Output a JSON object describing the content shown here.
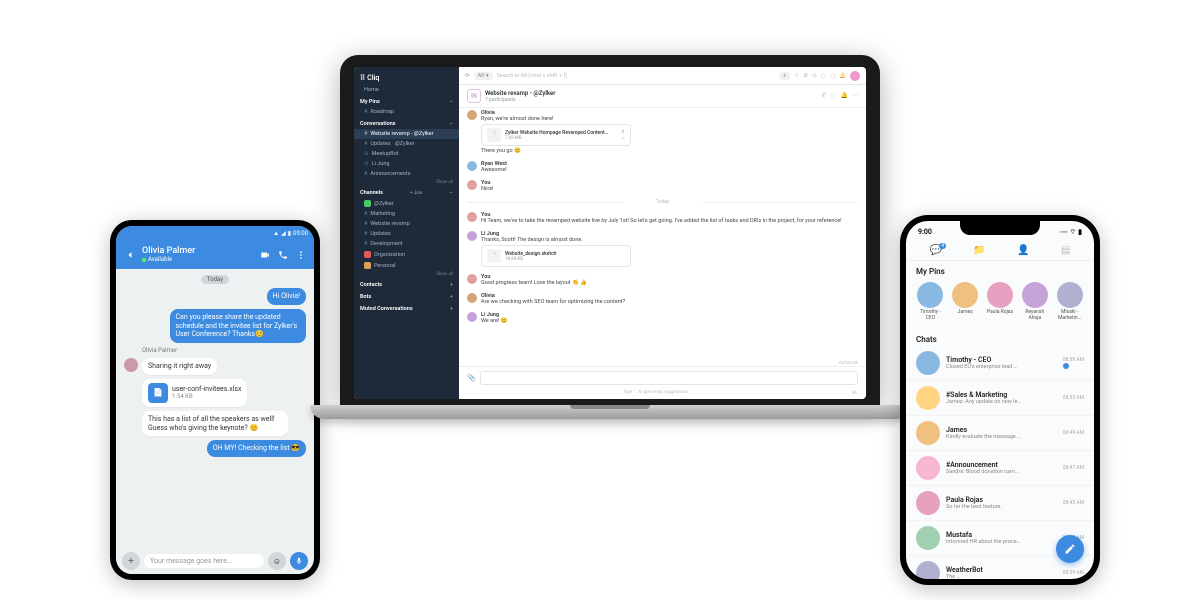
{
  "android": {
    "status_time": "09:00",
    "contact_name": "Olivia Palmer",
    "status_text": "Available",
    "today_label": "Today",
    "messages": {
      "m1": "Hi Olivia!",
      "m2": "Can you please share the updated schedule and the invitee list for Zylker's User Conference? Thanks😊",
      "sender_label": "Olivia Palmer",
      "m3": "Sharing it right away",
      "file_name": "user-conf-invitees.xlsx",
      "file_size": "1.54 KB",
      "m4": "This has a list of all the speakers as well! Guess who's giving the keynote? 😊",
      "m5": "OH MY! Checking the list 😎"
    },
    "composer_placeholder": "Your message goes here..."
  },
  "laptop": {
    "brand": "Cliq",
    "sidebar": {
      "home": "Home",
      "mypins": "My Pins",
      "roadmap": "Roadmap",
      "conversations": "Conversations",
      "conv": [
        "Website revamp - @Zylker",
        "Updates · @Zylker",
        "MeetupBot",
        "Li Jung",
        "Announcements"
      ],
      "showall": "Show all",
      "channels": "Channels",
      "channels_join": "+ Join",
      "ch": [
        "@Zylker",
        "Marketing",
        "Website revamp",
        "Updates",
        "Development",
        "Organization",
        "Personal"
      ],
      "contacts": "Contacts",
      "bots": "Bots",
      "muted": "Muted Conversations"
    },
    "topbar": {
      "all": "All",
      "search": "Search in All (cmd + shift + f)"
    },
    "channel_header": {
      "title": "Website revamp - @Zylker",
      "subtitle": "7 participants"
    },
    "feed": {
      "olivia": "Olivia",
      "olivia_text": "Ryan, we're almost done here!",
      "att1_name": "Zylker Website Hompage Revamped Content…",
      "att1_size": "7.43 MB",
      "olivia_text2": "There you go 😊",
      "ryan": "Ryan West",
      "ryan_text": "Awesome!",
      "you": "You",
      "you_text1": "Nice!",
      "today": "Today",
      "you_text2": "Hi Team, we've to take the revamped website live by July 1st! So let's get going. I've added the list of tasks and DRIs in the project, for your reference!",
      "li": "Li Jung",
      "li_text1": "Thanks, Scott! The design is almost done.",
      "att2_name": "Website_design.sketch",
      "att2_size": "18.69 KB",
      "you_text3": "Good progress team! Love the layout 👏 👍",
      "olivia2_text": "Are we checking with SEO team for optimizing the content?",
      "li_text2": "We are! 😊"
    },
    "hint": "Type \":\" to get emoji suggestions",
    "actions_label": "Actions",
    "markdown_label": "M↓"
  },
  "iphone": {
    "time": "9:00",
    "tab_badge": "4",
    "mypins": "My Pins",
    "pins": [
      {
        "name": "Timothy - CEO"
      },
      {
        "name": "James"
      },
      {
        "name": "Paula Rojas"
      },
      {
        "name": "Reyansh Ahuja"
      },
      {
        "name": "Misaki - Marketin…"
      }
    ],
    "chats_label": "Chats",
    "chats": [
      {
        "name": "Timothy - CEO",
        "preview": "Closed EU's enterprise lead …",
        "time": "08:58 AM",
        "badge": true
      },
      {
        "name": "#Sales & Marketing",
        "preview": "James: Any update on new le…",
        "time": "08:53 AM"
      },
      {
        "name": "James",
        "preview": "Kindly evaluate the message …",
        "time": "08:49 AM"
      },
      {
        "name": "#Announcement",
        "preview": "Sandra: Blood donation cam…",
        "time": "08:47 AM"
      },
      {
        "name": "Paula Rojas",
        "preview": "So far the best feature.",
        "time": "08:45 AM"
      },
      {
        "name": "Mustafa",
        "preview": "Informed HR about the proce…",
        "time": "08:40 AM"
      },
      {
        "name": "WeatherBot",
        "preview": "The …",
        "time": "08:39 AM"
      }
    ]
  }
}
